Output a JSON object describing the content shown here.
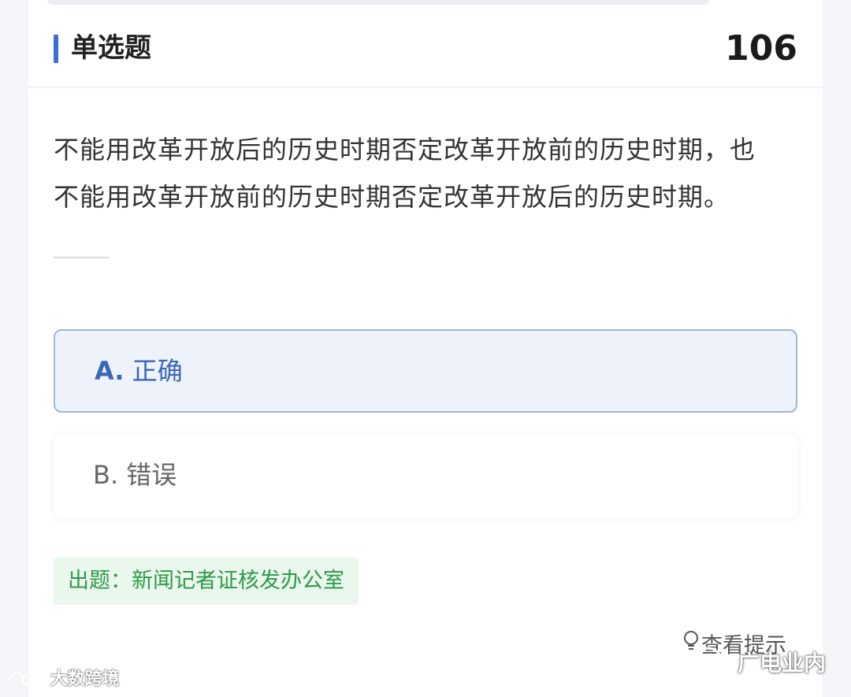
{
  "header": {
    "title": "单选题",
    "question_number": "106"
  },
  "question": {
    "line1": "不能用改革开放后的历史时期否定改革开放前的历史时期，也",
    "line2": "不能用改革开放前的历史时期否定改革开放后的历史时期。"
  },
  "options": [
    {
      "letter": "A.",
      "text": "正确",
      "selected": true
    },
    {
      "letter": "B.",
      "text": "错误",
      "selected": false
    }
  ],
  "source": "出题：新闻记者证核发办公室",
  "hint": {
    "label": "查看提示",
    "icon": "lightbulb-icon"
  },
  "watermarks": {
    "left": "大数跨境",
    "right": "广电业内"
  },
  "colors": {
    "accent": "#3a6fd8",
    "selected_bg": "#eef2fb",
    "selected_border": "#9fb6de",
    "source_green": "#2e9a4b",
    "source_bg": "#eaf7ec"
  }
}
